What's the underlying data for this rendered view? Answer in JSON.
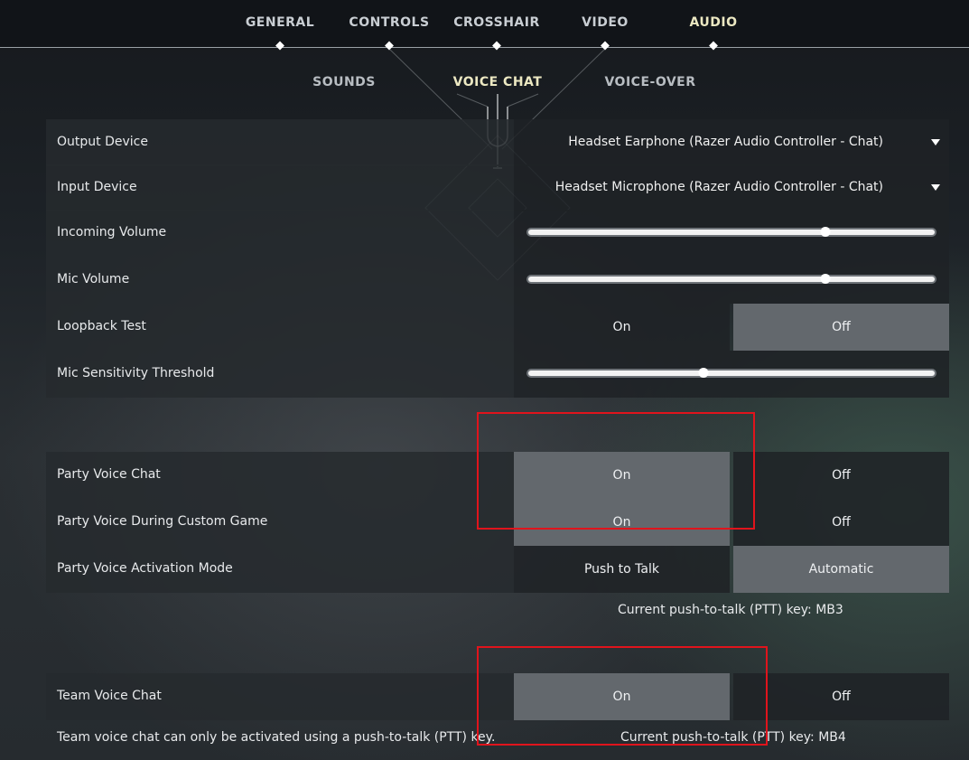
{
  "top_tabs": [
    {
      "label": "GENERAL"
    },
    {
      "label": "CONTROLS"
    },
    {
      "label": "CROSSHAIR"
    },
    {
      "label": "VIDEO"
    },
    {
      "label": "AUDIO",
      "active": true
    }
  ],
  "sub_tabs": [
    {
      "label": "SOUNDS"
    },
    {
      "label": "VOICE CHAT",
      "active": true
    },
    {
      "label": "VOICE-OVER"
    }
  ],
  "rows": {
    "output_device": {
      "label": "Output Device",
      "value": "Headset Earphone (Razer Audio Controller - Chat)",
      "icon": "chevron-down-icon"
    },
    "input_device": {
      "label": "Input Device",
      "value": "Headset Microphone (Razer Audio Controller - Chat)",
      "icon": "chevron-down-icon"
    },
    "incoming_volume": {
      "label": "Incoming Volume",
      "value": 0.73
    },
    "mic_volume": {
      "label": "Mic Volume",
      "value": 0.73
    },
    "loopback_test": {
      "label": "Loopback Test",
      "options": [
        "On",
        "Off"
      ],
      "selected": "Off"
    },
    "mic_sensitivity": {
      "label": "Mic Sensitivity Threshold",
      "value": 0.43
    },
    "party_voice_chat": {
      "label": "Party Voice Chat",
      "options": [
        "On",
        "Off"
      ],
      "selected": "On"
    },
    "party_voice_custom": {
      "label": "Party Voice During Custom Game",
      "options": [
        "On",
        "Off"
      ],
      "selected": "On"
    },
    "party_activation_mode": {
      "label": "Party Voice Activation Mode",
      "options": [
        "Push to Talk",
        "Automatic"
      ],
      "selected": "Automatic"
    },
    "team_voice_chat": {
      "label": "Team Voice Chat",
      "options": [
        "On",
        "Off"
      ],
      "selected": "On"
    }
  },
  "party_ptt_note": "Current push-to-talk (PTT) key: MB3",
  "team_info_note": "Team voice chat can only be activated using a push-to-talk (PTT) key.",
  "team_ptt_note": "Current push-to-talk (PTT) key: MB4",
  "colors": {
    "accent_active": "#ece8c2",
    "selected_option": "#63686d",
    "highlight_box": "#e0141c"
  }
}
